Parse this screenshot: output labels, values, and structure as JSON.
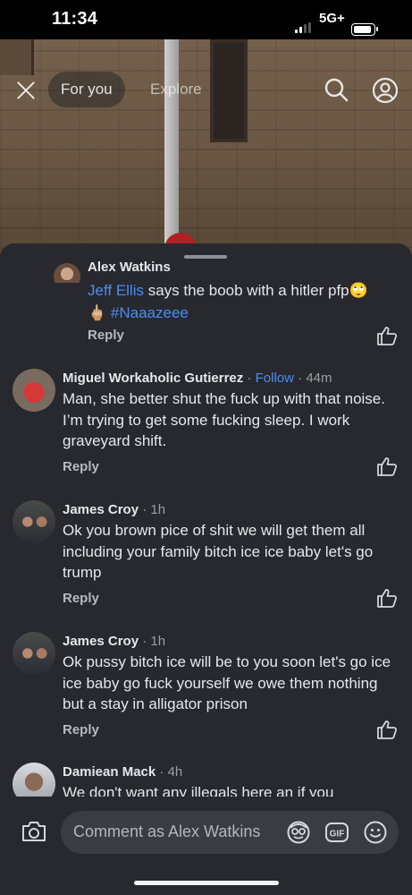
{
  "status": {
    "time": "11:34",
    "network": "5G+",
    "battery_level": 0.8
  },
  "nav": {
    "tab_for_you": "For you",
    "tab_explore": "Explore"
  },
  "partial_comment": {
    "author": "Alex Watkins",
    "mention": "Jeff Ellis",
    "text": " says the boob with a hitler pfp",
    "emoji": "🙄",
    "line2_emoji": "🖕🏼",
    "hashtag": "#Naaazeee",
    "reply": "Reply"
  },
  "comments": [
    {
      "author": "Miguel Workaholic Gutierrez",
      "follow": "Follow",
      "time": "44m",
      "body": "Man, she better shut the fuck up with that noise. I’m trying to get some fucking sleep. I work graveyard shift.",
      "reply": "Reply"
    },
    {
      "author": "James Croy",
      "time": "1h",
      "body": "Ok you brown pice of shit  we will get them all including your family  bitch ice ice  baby let's go trump",
      "reply": "Reply"
    },
    {
      "author": "James Croy",
      "time": "1h",
      "body": "Ok pussy bitch ice will be to you soon let's go ice ice baby go fuck yourself we owe them nothing but a  stay in alligator prison",
      "reply": "Reply"
    },
    {
      "author": "Damiean Mack",
      "time": "4h",
      "body": "We don't want  any  illegals  here an if you"
    }
  ],
  "composer": {
    "placeholder": "Comment as Alex Watkins",
    "gif_label": "GIF"
  },
  "colors": {
    "sheet": "#27292e",
    "link": "#4a8cf7",
    "input": "#3a3c42"
  }
}
